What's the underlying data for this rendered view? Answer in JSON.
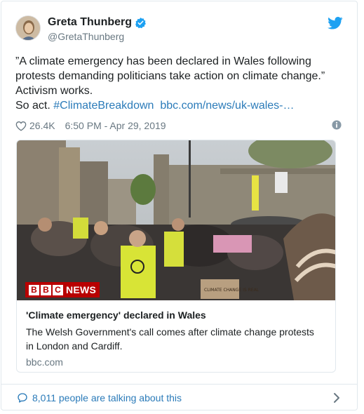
{
  "tweet": {
    "display_name": "Greta Thunberg",
    "handle": "@GretaThunberg",
    "verified": true,
    "text_lines": [
      "”A climate emergency has been declared in Wales following",
      "protests demanding politicians take action on climate change.”",
      "Activism works."
    ],
    "last_line_prefix": "So act. ",
    "hashtag": "#ClimateBreakdown",
    "link_text": "bbc.com/news/uk-wales-…",
    "likes": "26.4K",
    "timestamp": "6:50 PM - Apr 29, 2019"
  },
  "card": {
    "brand_letters": [
      "B",
      "B",
      "C"
    ],
    "brand_word": "NEWS",
    "title": "'Climate emergency' declared in Wales",
    "description_lines": [
      "The Welsh Government's call comes after climate change protests",
      "in London and Cardiff."
    ],
    "domain": "bbc.com",
    "sign_text": "CLIMATE CHANGE IS REAL"
  },
  "footer": {
    "conversation_text": "8,011 people are talking about this"
  },
  "icons": {
    "verified": "verified-badge-icon",
    "twitter": "twitter-bird-icon",
    "like": "heart-icon",
    "info": "info-icon",
    "reply": "speech-bubble-icon",
    "more": "chevron-right-icon"
  },
  "colors": {
    "link": "#2b7bb9",
    "muted": "#697882",
    "border": "#e1e8ed",
    "twitter_blue": "#1da1f2",
    "bbc_red": "#b80000"
  }
}
